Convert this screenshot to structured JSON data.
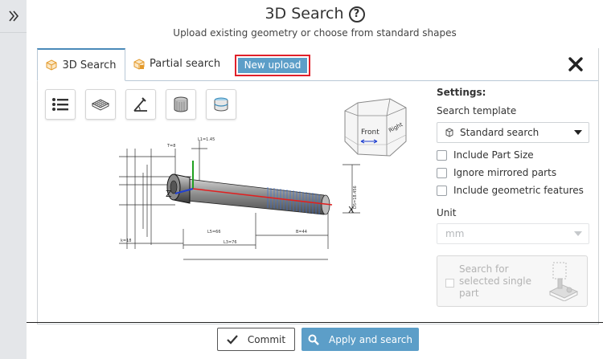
{
  "header": {
    "title": "3D Search",
    "subtitle": "Upload existing geometry or choose from standard shapes"
  },
  "tabs": [
    {
      "label": "3D Search"
    },
    {
      "label": "Partial search"
    }
  ],
  "new_upload_label": "New upload",
  "viewcube": {
    "front": "Front",
    "right": "Right"
  },
  "model_labels": {
    "d1": "L1=1.45",
    "d2": "T=8",
    "d3": "L3=76",
    "d4": "L5=66",
    "d5": "B=44",
    "d6": "D5=18.456",
    "d7": "Z",
    "d8": "X",
    "d9": "k=18"
  },
  "settings": {
    "heading": "Settings:",
    "template_label": "Search template",
    "template_value": "Standard search",
    "options": [
      {
        "label": "Include Part Size"
      },
      {
        "label": "Ignore mirrored parts"
      },
      {
        "label": "Include geometric features"
      }
    ],
    "unit_label": "Unit",
    "unit_value": "mm",
    "search_part_label": "Search for selected single part"
  },
  "footer": {
    "commit": "Commit",
    "apply": "Apply and search"
  },
  "colors": {
    "accent": "#5c9ec8",
    "highlight_border": "#e0202a",
    "tab_top": "#4a8ab9"
  }
}
